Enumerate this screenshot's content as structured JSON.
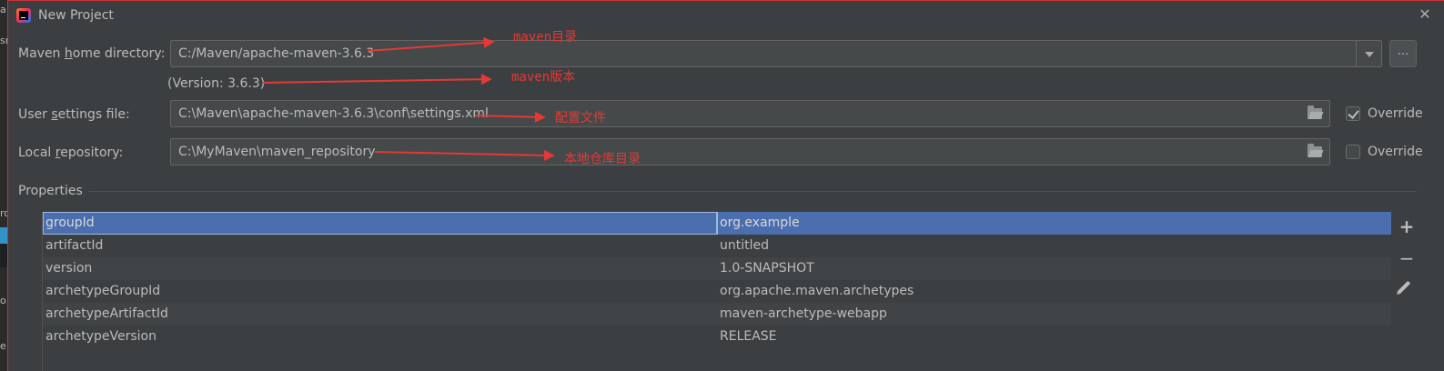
{
  "background_window": {
    "edge_chars": [
      "a",
      "sr",
      "ro",
      "o",
      "e"
    ]
  },
  "dialog": {
    "title": "New Project"
  },
  "maven_home": {
    "label_pre": "Maven ",
    "label_mnemonic": "h",
    "label_post": "ome directory:",
    "value": "C:/Maven/apache-maven-3.6.3",
    "browse_label": "...",
    "version_text": "(Version: 3.6.3)"
  },
  "user_settings": {
    "label_pre": "User ",
    "label_mnemonic": "s",
    "label_post": "ettings file:",
    "value": "C:\\Maven\\apache-maven-3.6.3\\conf\\settings.xml",
    "override_label": "Override",
    "override_checked": true
  },
  "local_repo": {
    "label_pre": "Local ",
    "label_mnemonic": "r",
    "label_post": "epository:",
    "value": "C:\\MyMaven\\maven_repository",
    "override_label": "Override",
    "override_checked": false
  },
  "properties": {
    "title": "Properties",
    "rows": [
      {
        "key": "groupId",
        "value": "org.example",
        "selected": true
      },
      {
        "key": "artifactId",
        "value": "untitled"
      },
      {
        "key": "version",
        "value": "1.0-SNAPSHOT"
      },
      {
        "key": "archetypeGroupId",
        "value": "org.apache.maven.archetypes"
      },
      {
        "key": "archetypeArtifactId",
        "value": "maven-archetype-webapp"
      },
      {
        "key": "archetypeVersion",
        "value": "RELEASE"
      }
    ],
    "tools": [
      "plus-icon",
      "minus-icon",
      "pencil-icon"
    ]
  },
  "annotations": {
    "maven_dir": "maven目录",
    "maven_version": "maven版本",
    "config_file": "配置文件",
    "local_repo": "本地仓库目录",
    "color": "#e53935"
  }
}
